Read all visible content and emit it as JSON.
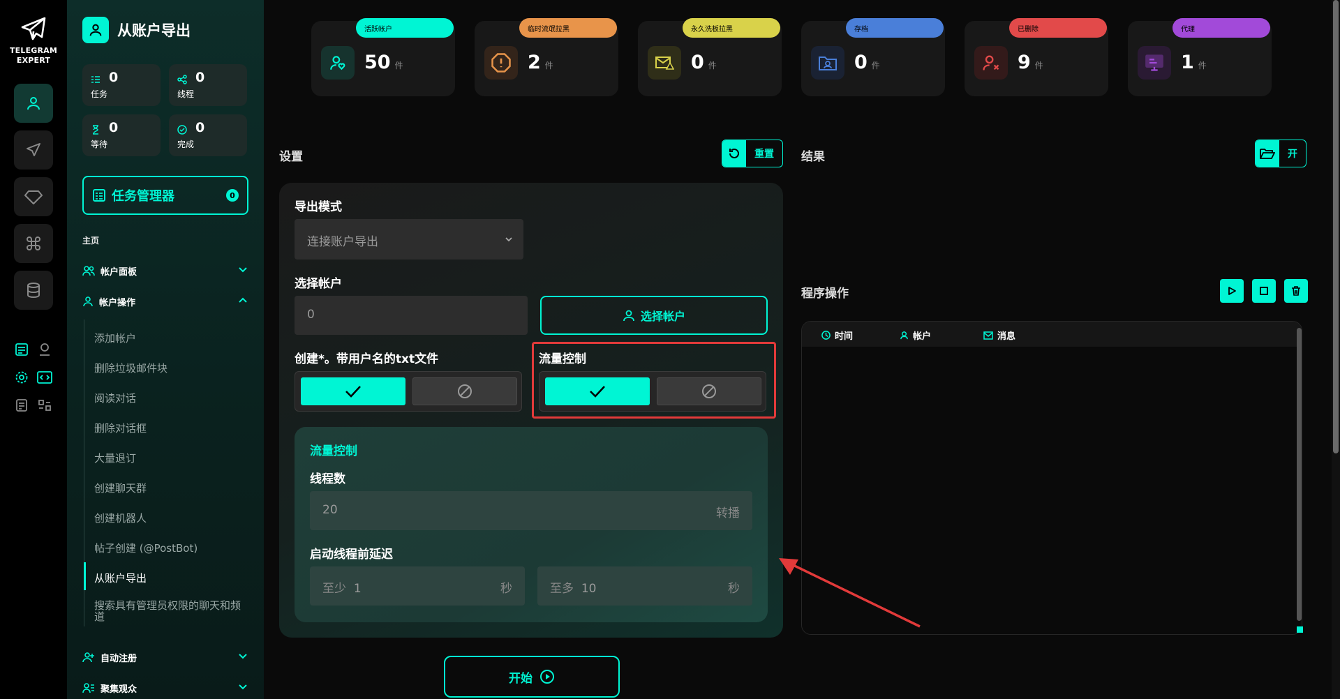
{
  "app": {
    "logo_line1": "TELEGRAM",
    "logo_line2": "EXPERT"
  },
  "header": {
    "title": "从账户导出"
  },
  "stats": [
    {
      "value": "0",
      "label": "任务"
    },
    {
      "value": "0",
      "label": "线程"
    },
    {
      "value": "0",
      "label": "等待"
    },
    {
      "value": "0",
      "label": "完成"
    }
  ],
  "task_manager": {
    "label": "任务管理器",
    "count": "0"
  },
  "nav": {
    "section": "主页",
    "groups": [
      {
        "label": "帐户面板"
      },
      {
        "label": "帐户操作"
      },
      {
        "label": "自动注册"
      },
      {
        "label": "聚集观众"
      }
    ],
    "sub_items": [
      "添加帐户",
      "删除垃圾邮件块",
      "阅读对话",
      "删除对话框",
      "大量退订",
      "创建聊天群",
      "创建机器人",
      "帖子创建 (@PostBot)",
      "从账户导出",
      "搜索具有管理员权限的聊天和频道"
    ]
  },
  "top_cards": [
    {
      "tag": "活跃帐户",
      "value": "50",
      "unit": "件",
      "color": "#00f5d4",
      "icon": "user-heart-icon"
    },
    {
      "tag": "临时流氓拉黑",
      "value": "2",
      "unit": "件",
      "color": "#e8944a",
      "icon": "warning-octagon-icon"
    },
    {
      "tag": "永久洗板拉黑",
      "value": "0",
      "unit": "件",
      "color": "#d9d24a",
      "icon": "mail-warning-icon"
    },
    {
      "tag": "存档",
      "value": "0",
      "unit": "件",
      "color": "#4a7fd9",
      "icon": "folder-user-icon"
    },
    {
      "tag": "已删除",
      "value": "9",
      "unit": "件",
      "color": "#e24a4a",
      "icon": "user-x-icon"
    },
    {
      "tag": "代理",
      "value": "1",
      "unit": "件",
      "color": "#a24ad9",
      "icon": "proxy-screen-icon"
    }
  ],
  "settings": {
    "title": "设置",
    "reset_label": "重置",
    "export_mode_label": "导出模式",
    "export_mode_value": "连接账户导出",
    "select_accounts_label": "选择帐户",
    "select_accounts_value": "0",
    "select_accounts_button": "选择帐户",
    "create_txt_label": "创建*。带用户名的txt文件",
    "flow_control_label": "流量控制",
    "inner": {
      "title": "流量控制",
      "threads_label": "线程数",
      "threads_value": "20",
      "threads_suffix": "转播",
      "delay_label": "启动线程前延迟",
      "min_prefix": "至少",
      "min_value": "1",
      "max_prefix": "至多",
      "max_value": "10",
      "unit": "秒"
    },
    "start_label": "开始"
  },
  "results": {
    "title": "结果",
    "open_label": "开"
  },
  "ops": {
    "title": "程序操作",
    "columns": [
      "时间",
      "帐户",
      "消息"
    ]
  },
  "colors": {
    "accent": "#00f5d4",
    "highlight": "#e23a3a"
  }
}
